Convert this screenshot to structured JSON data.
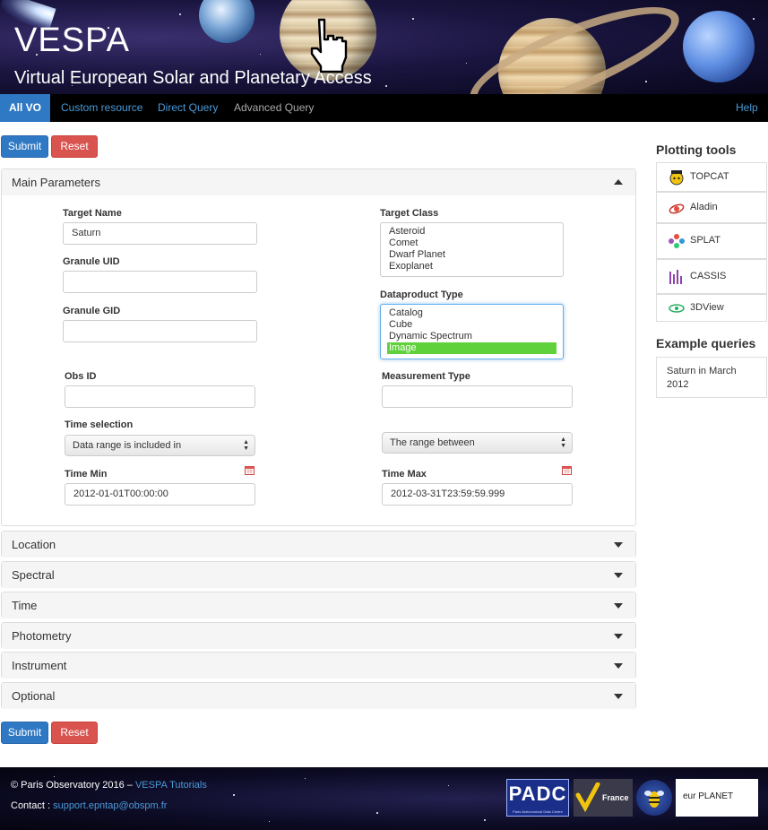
{
  "banner": {
    "title": "VESPA",
    "subtitle": "Virtual European Solar and Planetary Access"
  },
  "nav": {
    "items": [
      {
        "label": "All VO",
        "active": true
      },
      {
        "label": "Custom resource"
      },
      {
        "label": "Direct Query"
      },
      {
        "label": "Advanced Query"
      }
    ],
    "help": "Help"
  },
  "actions": {
    "submit": "Submit",
    "reset": "Reset"
  },
  "main_panel": {
    "title": "Main Parameters",
    "target_name": {
      "label": "Target Name",
      "value": "Saturn"
    },
    "granule_uid": {
      "label": "Granule UID",
      "value": ""
    },
    "granule_gid": {
      "label": "Granule GID",
      "value": ""
    },
    "target_class": {
      "label": "Target Class",
      "options": [
        "Asteroid",
        "Comet",
        "Dwarf Planet",
        "Exoplanet"
      ]
    },
    "dataproduct_type": {
      "label": "Dataproduct Type",
      "options": [
        "Catalog",
        "Cube",
        "Dynamic Spectrum",
        "Image"
      ],
      "selected": "Image"
    },
    "obs_id": {
      "label": "Obs ID",
      "value": ""
    },
    "measurement_type": {
      "label": "Measurement Type",
      "value": ""
    },
    "time_selection": {
      "label": "Time selection",
      "value": "Data range is included in"
    },
    "range_select": {
      "value": "The range between"
    },
    "time_min": {
      "label": "Time Min",
      "value": "2012-01-01T00:00:00"
    },
    "time_max": {
      "label": "Time Max",
      "value": "2012-03-31T23:59:59.999"
    }
  },
  "collapsed_panels": [
    "Location",
    "Spectral",
    "Time",
    "Photometry",
    "Instrument",
    "Optional"
  ],
  "sidebar": {
    "plotting_title": "Plotting tools",
    "tools": [
      {
        "label": "TOPCAT",
        "icon": "topcat-icon"
      },
      {
        "label": "Aladin",
        "icon": "aladin-icon"
      },
      {
        "label": "SPLAT",
        "icon": "splat-icon"
      },
      {
        "label": "CASSIS",
        "icon": "cassis-icon"
      },
      {
        "label": "3DView",
        "icon": "3dview-icon"
      }
    ],
    "examples_title": "Example queries",
    "examples": [
      "Saturn in March 2012"
    ]
  },
  "footer": {
    "copyright": "© Paris Observatory 2016 – ",
    "tutorials": "VESPA Tutorials",
    "contact_label": "Contact : ",
    "contact_email": "support.epntap@obspm.fr",
    "logos": {
      "padc": "PADC",
      "padc_sub": "Paris Astronomical Data Centre",
      "france": "France",
      "europlanet": "eur PLANET"
    }
  },
  "colors": {
    "primary": "#2f79c4",
    "danger": "#d9534f",
    "selected": "#5fd13a",
    "link": "#4a9ad8"
  }
}
